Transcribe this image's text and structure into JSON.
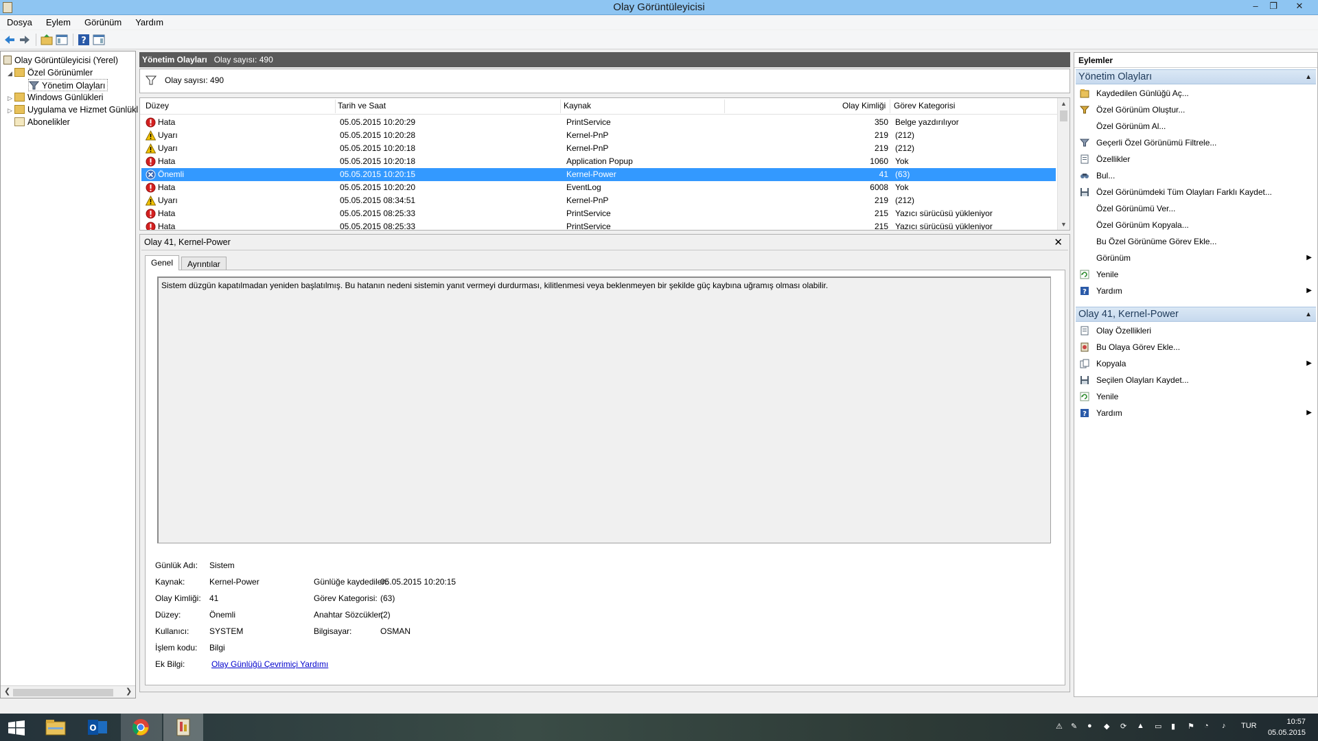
{
  "window": {
    "title": "Olay Görüntüleyicisi",
    "controls": [
      "–",
      "❐",
      "✕"
    ]
  },
  "menu": [
    "Dosya",
    "Eylem",
    "Görünüm",
    "Yardım"
  ],
  "tree": {
    "items": [
      {
        "label": "Olay Görüntüleyicisi (Yerel)"
      },
      {
        "label": "Özel Görünümler"
      },
      {
        "label": "Yönetim Olayları"
      },
      {
        "label": "Windows Günlükleri"
      },
      {
        "label": "Uygulama ve Hizmet Günlükl"
      },
      {
        "label": "Abonelikler"
      }
    ]
  },
  "center": {
    "header_title": "Yönetim Olayları",
    "header_count": "Olay sayısı: 490",
    "filter_text": "Olay sayısı: 490",
    "columns": [
      "Düzey",
      "Tarih ve Saat",
      "Kaynak",
      "Olay Kimliği",
      "Görev Kategorisi"
    ],
    "rows": [
      {
        "level": "Hata",
        "icon": "error",
        "date": "05.05.2015 10:20:29",
        "source": "PrintService",
        "id": "350",
        "category": "Belge yazdırılıyor"
      },
      {
        "level": "Uyarı",
        "icon": "warning",
        "date": "05.05.2015 10:20:28",
        "source": "Kernel-PnP",
        "id": "219",
        "category": "(212)"
      },
      {
        "level": "Uyarı",
        "icon": "warning",
        "date": "05.05.2015 10:20:18",
        "source": "Kernel-PnP",
        "id": "219",
        "category": "(212)"
      },
      {
        "level": "Hata",
        "icon": "error",
        "date": "05.05.2015 10:20:18",
        "source": "Application Popup",
        "id": "1060",
        "category": "Yok"
      },
      {
        "level": "Önemli",
        "icon": "critical",
        "date": "05.05.2015 10:20:15",
        "source": "Kernel-Power",
        "id": "41",
        "category": "(63)",
        "selected": true
      },
      {
        "level": "Hata",
        "icon": "error",
        "date": "05.05.2015 10:20:20",
        "source": "EventLog",
        "id": "6008",
        "category": "Yok"
      },
      {
        "level": "Uyarı",
        "icon": "warning",
        "date": "05.05.2015 08:34:51",
        "source": "Kernel-PnP",
        "id": "219",
        "category": "(212)"
      },
      {
        "level": "Hata",
        "icon": "error",
        "date": "05.05.2015 08:25:33",
        "source": "PrintService",
        "id": "215",
        "category": "Yazıcı sürücüsü yükleniyor"
      },
      {
        "level": "Hata",
        "icon": "error",
        "date": "05.05.2015 08:25:33",
        "source": "PrintService",
        "id": "215",
        "category": "Yazıcı sürücüsü yükleniyor"
      }
    ]
  },
  "detail": {
    "title": "Olay 41, Kernel-Power",
    "tabs": [
      "Genel",
      "Ayrıntılar"
    ],
    "description": "Sistem düzgün kapatılmadan yeniden başlatılmış. Bu hatanın nedeni sistemin yanıt vermeyi durdurması, kilitlenmesi veya beklenmeyen bir şekilde güç kaybına uğramış olması olabilir.",
    "props_left": [
      {
        "label": "Günlük Adı:",
        "value": "Sistem"
      },
      {
        "label": "Kaynak:",
        "value": "Kernel-Power"
      },
      {
        "label": "Olay Kimliği:",
        "value": "41"
      },
      {
        "label": "Düzey:",
        "value": "Önemli"
      },
      {
        "label": "Kullanıcı:",
        "value": "SYSTEM"
      },
      {
        "label": "İşlem kodu:",
        "value": "Bilgi"
      },
      {
        "label": "Ek Bilgi:",
        "value": "Olay Günlüğü Çevrimiçi Yardımı"
      }
    ],
    "props_right": [
      {
        "label": "Günlüğe kaydedilen:",
        "value": "05.05.2015 10:20:15"
      },
      {
        "label": "Görev Kategorisi:",
        "value": "(63)"
      },
      {
        "label": "Anahtar Sözcükler:",
        "value": "(2)"
      },
      {
        "label": "Bilgisayar:",
        "value": "OSMAN"
      }
    ]
  },
  "actions": {
    "header": "Eylemler",
    "section1": {
      "title": "Yönetim Olayları",
      "items": [
        {
          "label": "Kaydedilen Günlüğü Aç...",
          "icon": "open-log-icon"
        },
        {
          "label": "Özel Görünüm Oluştur...",
          "icon": "create-view-icon"
        },
        {
          "label": "Özel Görünüm Al...",
          "icon": ""
        },
        {
          "label": "Geçerli Özel Görünümü Filtrele...",
          "icon": "filter-icon"
        },
        {
          "label": "Özellikler",
          "icon": "properties-icon"
        },
        {
          "label": "Bul...",
          "icon": "find-icon"
        },
        {
          "label": "Özel Görünümdeki Tüm Olayları Farklı Kaydet...",
          "icon": "save-icon"
        },
        {
          "label": "Özel Görünümü Ver...",
          "icon": ""
        },
        {
          "label": "Özel Görünüm Kopyala...",
          "icon": ""
        },
        {
          "label": "Bu Özel Görünüme Görev Ekle...",
          "icon": ""
        },
        {
          "label": "Görünüm",
          "icon": "",
          "submenu": true
        },
        {
          "label": "Yenile",
          "icon": "refresh-icon"
        },
        {
          "label": "Yardım",
          "icon": "help-icon",
          "submenu": true
        }
      ]
    },
    "section2": {
      "title": "Olay 41, Kernel-Power",
      "items": [
        {
          "label": "Olay Özellikleri",
          "icon": "event-properties-icon"
        },
        {
          "label": "Bu Olaya Görev Ekle...",
          "icon": "task-icon"
        },
        {
          "label": "Kopyala",
          "icon": "copy-icon",
          "submenu": true
        },
        {
          "label": "Seçilen Olayları Kaydet...",
          "icon": "save-icon"
        },
        {
          "label": "Yenile",
          "icon": "refresh-icon"
        },
        {
          "label": "Yardım",
          "icon": "help-icon",
          "submenu": true
        }
      ]
    }
  },
  "taskbar": {
    "language": "TUR",
    "time": "10:57",
    "date": "05.05.2015"
  },
  "colors": {
    "titlebar": "#8ec5f2",
    "selection": "#3399ff",
    "link": "#0000cc"
  }
}
